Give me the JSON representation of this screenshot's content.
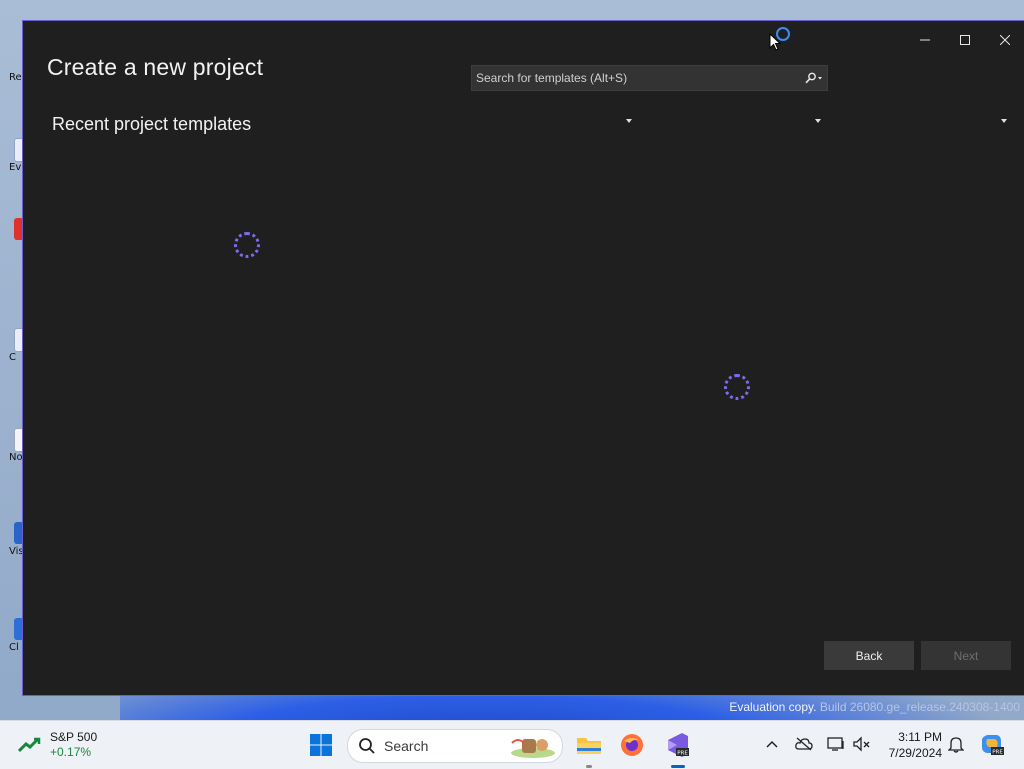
{
  "window": {
    "title": "Create a new project",
    "search": {
      "placeholder": "Search for templates (Alt+S)"
    },
    "section_title": "Recent project templates",
    "buttons": {
      "back": "Back",
      "next": "Next"
    },
    "controls": {
      "minimize": "—",
      "maximize": "☐",
      "close": "✕"
    }
  },
  "desktop": {
    "icons": [
      {
        "label": "Re"
      },
      {
        "label": "Ev"
      },
      {
        "label": ""
      },
      {
        "label": "C"
      },
      {
        "label": "No"
      },
      {
        "label": "Vis"
      },
      {
        "label": "Cl"
      }
    ],
    "watermark": {
      "line": "Evaluation copy.",
      "build": "Build 26080.ge_release.240308-1400"
    }
  },
  "taskbar": {
    "stock": {
      "name": "S&P 500",
      "change": "+0.17%"
    },
    "search_label": "Search",
    "clock": {
      "time": "3:11 PM",
      "date": "7/29/2024"
    }
  },
  "colors": {
    "window_bg": "#1f1f1f",
    "accent": "#6b5fd0",
    "spinner": "#7b6df0",
    "stock_up": "#16883e"
  }
}
